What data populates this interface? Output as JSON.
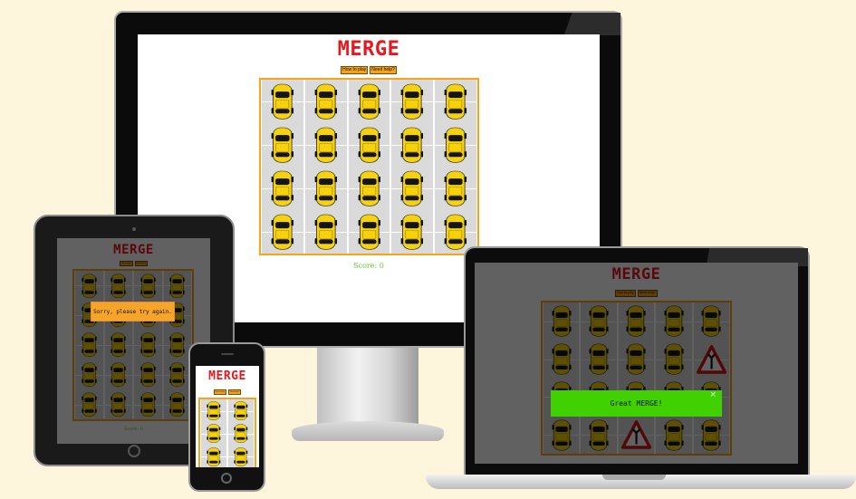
{
  "game": {
    "title": "MERGE",
    "how_to_play_label": "How to play",
    "need_help_label": "Need help?",
    "score_text": "Score: 0"
  },
  "modals": {
    "sorry_text": "Sorry, please try again.",
    "merge_text": "Great MERGE!",
    "close_icon": "×"
  },
  "boards": {
    "monitor": {
      "cols": 5,
      "rows": 4,
      "cells": [
        "car",
        "car",
        "car",
        "car",
        "car",
        "car",
        "car",
        "car",
        "car",
        "car",
        "car",
        "car",
        "car",
        "car",
        "car",
        "car",
        "car",
        "car",
        "car",
        "car"
      ]
    },
    "tablet": {
      "cols": 4,
      "rows": 5,
      "cells": [
        "car",
        "car",
        "car",
        "car",
        "car",
        "car",
        "car",
        "car",
        "car",
        "car",
        "car",
        "car",
        "car",
        "car",
        "car",
        "car",
        "car",
        "car",
        "car",
        "car"
      ]
    },
    "phone": {
      "cols": 2,
      "rows": 3,
      "cells": [
        "car",
        "car",
        "car",
        "car",
        "car",
        "car"
      ]
    },
    "laptop": {
      "cols": 5,
      "rows": 4,
      "cells": [
        "car",
        "car",
        "car",
        "car",
        "car",
        "car",
        "car",
        "car",
        "car",
        "sign",
        "car",
        "car",
        "car",
        "car",
        "car",
        "car",
        "car",
        "sign",
        "car",
        "car"
      ]
    }
  },
  "colors": {
    "title": "#e8171d",
    "button": "#f4a31b",
    "score": "#5ad132",
    "car": "#f5d20b",
    "sorry_modal": "#f7a42a",
    "merge_modal": "#41d000"
  },
  "icons": {
    "car": "car-top-view-icon",
    "sign": "merge-warning-sign-icon",
    "close": "close-icon"
  }
}
